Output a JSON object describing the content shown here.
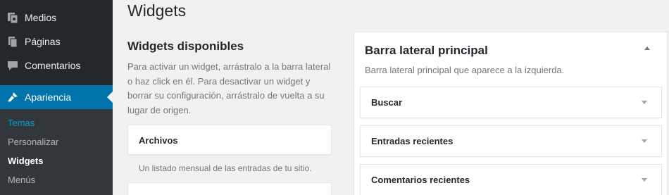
{
  "sidebar": {
    "items": [
      {
        "label": "Medios",
        "icon": "media-icon"
      },
      {
        "label": "Páginas",
        "icon": "pages-icon"
      },
      {
        "label": "Comentarios",
        "icon": "comments-icon"
      },
      {
        "label": "Apariencia",
        "icon": "appearance-brush-icon"
      }
    ],
    "submenu": [
      "Temas",
      "Personalizar",
      "Widgets",
      "Menús"
    ]
  },
  "page": {
    "title": "Widgets"
  },
  "available": {
    "title": "Widgets disponibles",
    "description": "Para activar un widget, arrástralo a la barra lateral o haz click en él. Para desactivar un widget y borrar su configuración, arrástralo de vuelta a su lugar de origen.",
    "widgets": [
      {
        "title": "Archivos",
        "description": "Un listado mensual de las entradas de tu sitio."
      }
    ]
  },
  "sidebar_area": {
    "title": "Barra lateral principal",
    "description": "Barra lateral principal que aparece a la izquierda.",
    "widgets": [
      "Buscar",
      "Entradas recientes",
      "Comentarios recientes"
    ]
  },
  "colors": {
    "admin_menu_bg": "#23282d",
    "submenu_bg": "#32373c",
    "accent": "#0073aa",
    "active_submenu": "#00a0d2"
  }
}
